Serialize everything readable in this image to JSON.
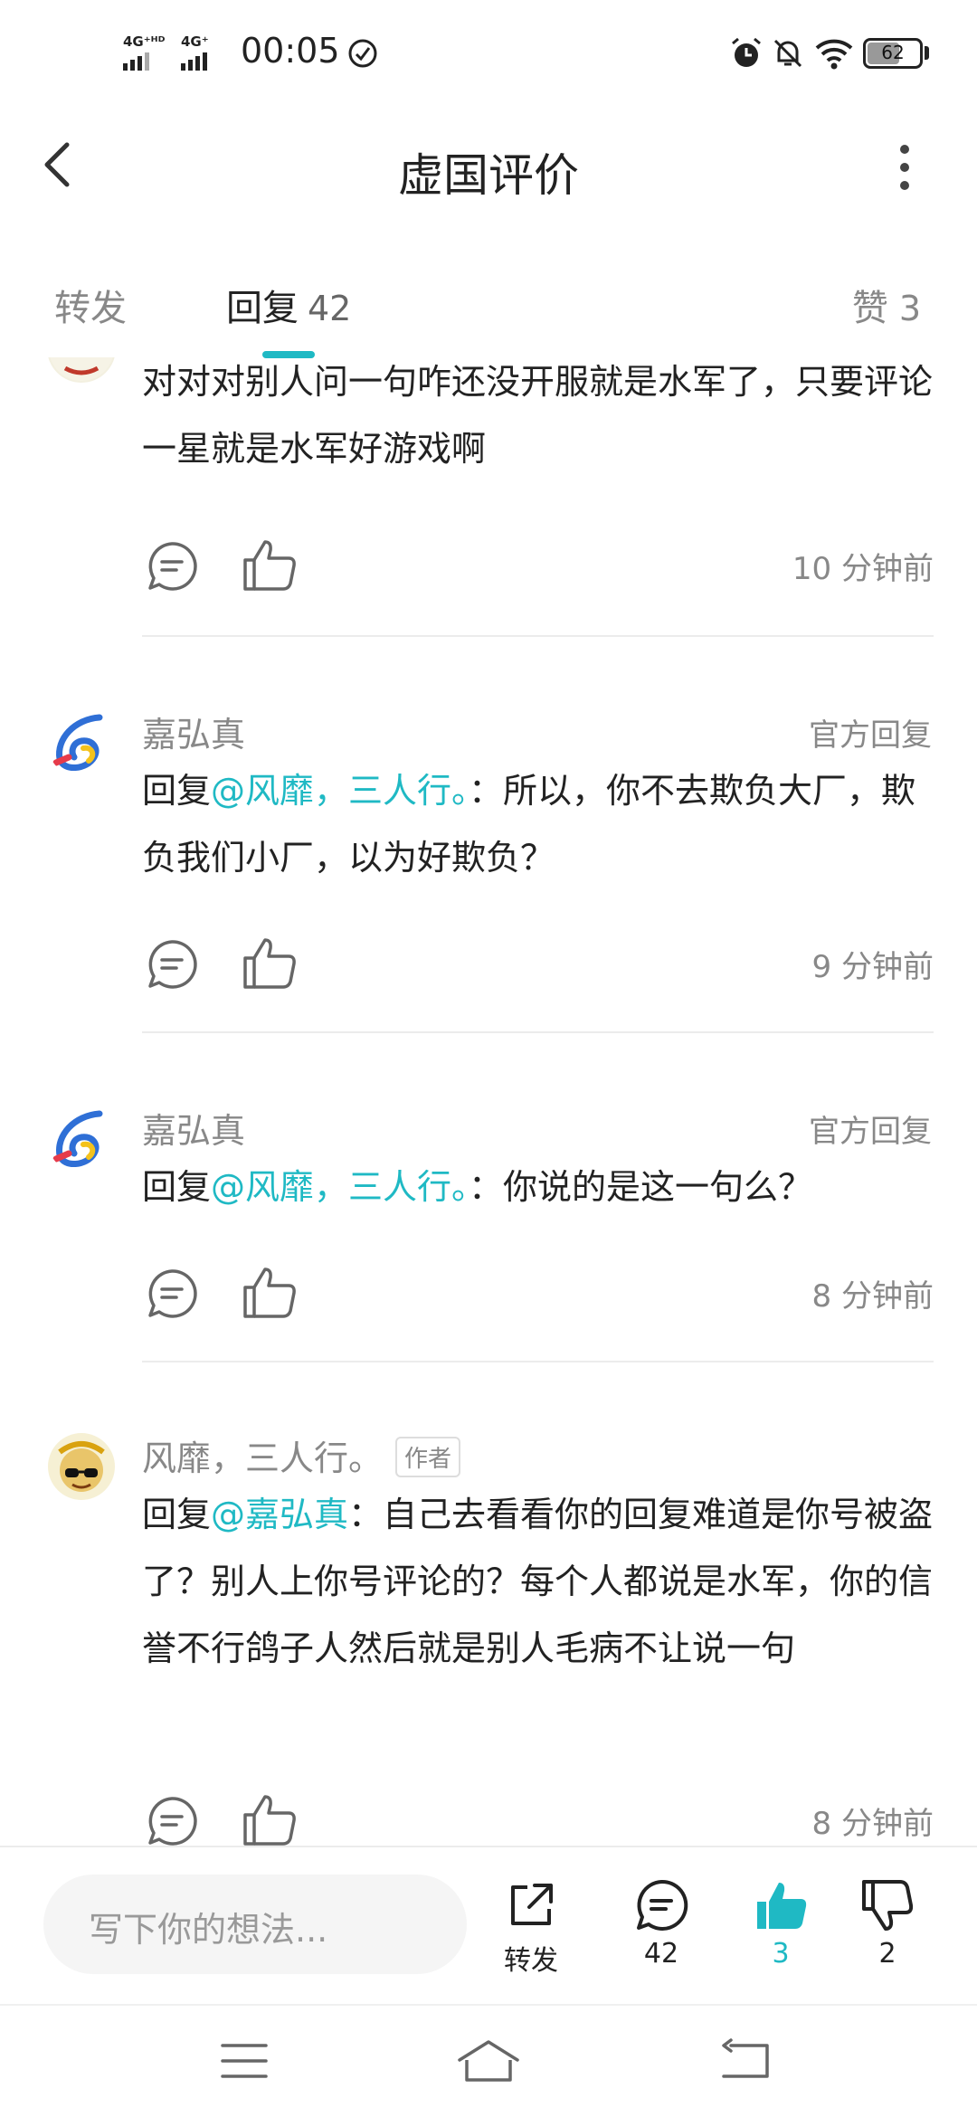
{
  "status_bar": {
    "sim1_label": "4G⁺ᴴᴰ",
    "sim2_label": "4G⁺",
    "time": "00:05",
    "battery": "62",
    "battery_level": 0.62
  },
  "header": {
    "title": "虚国评价"
  },
  "tabs": {
    "repost_label": "转发",
    "reply_label": "回复",
    "reply_count": "42",
    "like_label": "赞",
    "like_count": "3"
  },
  "comments": [
    {
      "body": "对对对别人问一句咋还没开服就是水军了，只要评论一星就是水军好游戏啊",
      "time": "10 分钟前"
    },
    {
      "name": "嘉弘真",
      "official": "官方回复",
      "reply_prefix": "回复",
      "mention": "@风靡，三人行。",
      "body": "：所以，你不去欺负大厂，欺负我们小厂，以为好欺负？",
      "time": "9 分钟前"
    },
    {
      "name": "嘉弘真",
      "official": "官方回复",
      "reply_prefix": "回复",
      "mention": "@风靡，三人行。",
      "body": "：你说的是这一句么？",
      "time": "8 分钟前"
    },
    {
      "name": "风靡，三人行。",
      "badge": "作者",
      "reply_prefix": "回复",
      "mention": "@嘉弘真",
      "body": "：自己去看看你的回复难道是你号被盗了？别人上你号评论的？每个人都说是水军，你的信誉不行鸽子人然后就是别人毛病不让说一句",
      "time": "8 分钟前"
    }
  ],
  "bottom_bar": {
    "input_placeholder": "写下你的想法...",
    "share_label": "转发",
    "comment_count": "42",
    "like_count": "3",
    "dislike_count": "2"
  },
  "colors": {
    "accent": "#1fb9c4",
    "muted": "#888888"
  }
}
